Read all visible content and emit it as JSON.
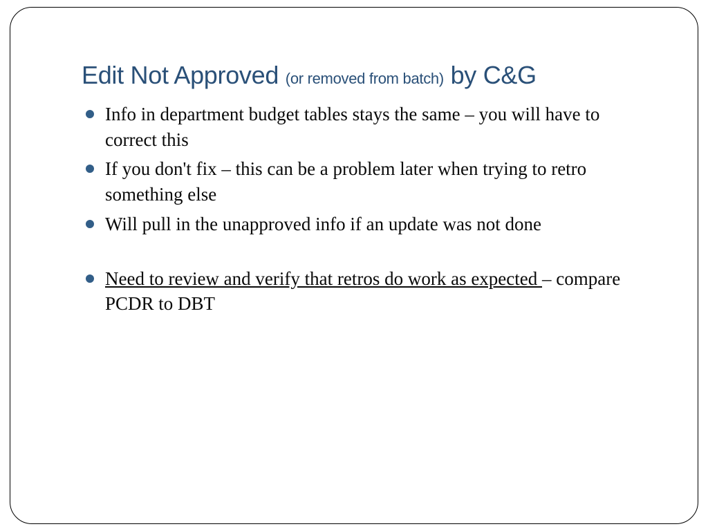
{
  "title": {
    "part1": "Edit Not Approved ",
    "small": "(or removed from batch)",
    "part2": " by C&G"
  },
  "bullets": {
    "b1": "Info in department budget tables stays the same – you will have to correct this",
    "b2": "If you don't fix – this can be a problem later when trying to retro something else",
    "b3": "Will pull in the unapproved info if an update was not done",
    "b4_underline": "Need to review and verify that retros do work as expected ",
    "b4_rest": "– compare PCDR to DBT"
  }
}
